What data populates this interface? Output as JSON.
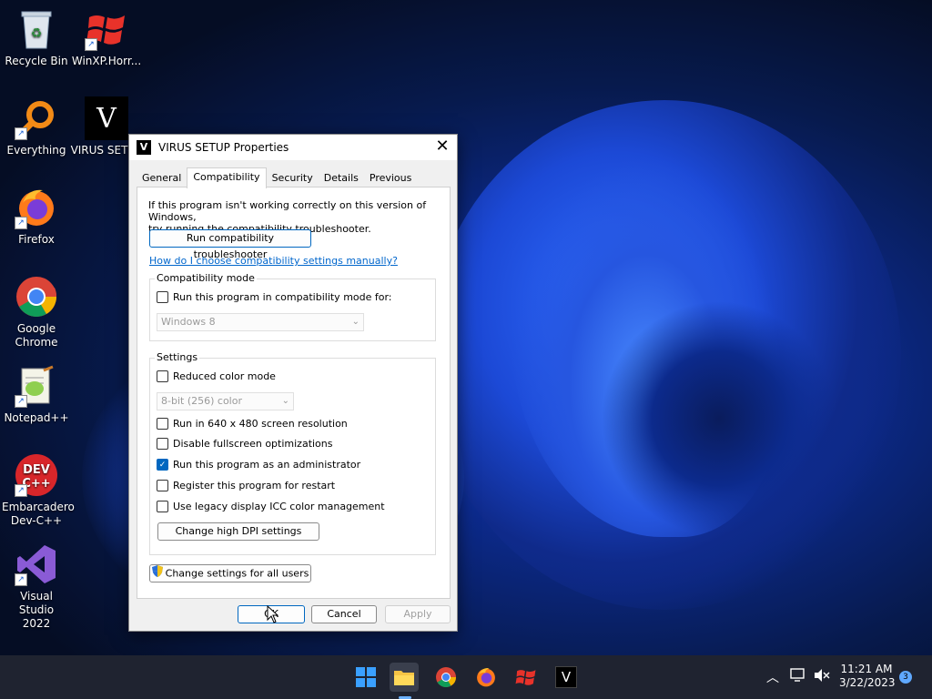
{
  "desktop": {
    "icons": [
      {
        "label": "Recycle Bin"
      },
      {
        "label": "WinXP.Horr..."
      },
      {
        "label": "Everything"
      },
      {
        "label": "VIRUS SETUP"
      },
      {
        "label": "Firefox"
      },
      {
        "label": "Google Chrome"
      },
      {
        "label": "Notepad++"
      },
      {
        "label": "Embarcadero Dev-C++"
      },
      {
        "label": "Visual Studio 2022"
      }
    ]
  },
  "dialog": {
    "title": "VIRUS SETUP Properties",
    "logo_letter": "V",
    "tabs": [
      "General",
      "Compatibility",
      "Security",
      "Details",
      "Previous Versions"
    ],
    "active_tab": "Compatibility",
    "intro_line1": "If this program isn't working correctly on this version of Windows,",
    "intro_line2": "try running the compatibility troubleshooter.",
    "troubleshooter_button": "Run compatibility troubleshooter",
    "help_link": "How do I choose compatibility settings manually?",
    "compat_mode": {
      "group_label": "Compatibility mode",
      "checkbox_label": "Run this program in compatibility mode for:",
      "checked": false,
      "os_value": "Windows 8"
    },
    "settings": {
      "group_label": "Settings",
      "reduced_color": {
        "label": "Reduced color mode",
        "checked": false
      },
      "color_value": "8-bit (256) color",
      "resolution": {
        "label": "Run in 640 x 480 screen resolution",
        "checked": false
      },
      "fullscreen": {
        "label": "Disable fullscreen optimizations",
        "checked": false
      },
      "admin": {
        "label": "Run this program as an administrator",
        "checked": true
      },
      "restart": {
        "label": "Register this program for restart",
        "checked": false
      },
      "icc": {
        "label": "Use legacy display ICC color management",
        "checked": false
      },
      "dpi_button": "Change high DPI settings"
    },
    "all_users_button": "Change settings for all users",
    "ok_button": "OK",
    "cancel_button": "Cancel",
    "apply_button": "Apply"
  },
  "taskbar": {
    "time": "11:21 AM",
    "date": "3/22/2023",
    "notification_count": "3"
  }
}
